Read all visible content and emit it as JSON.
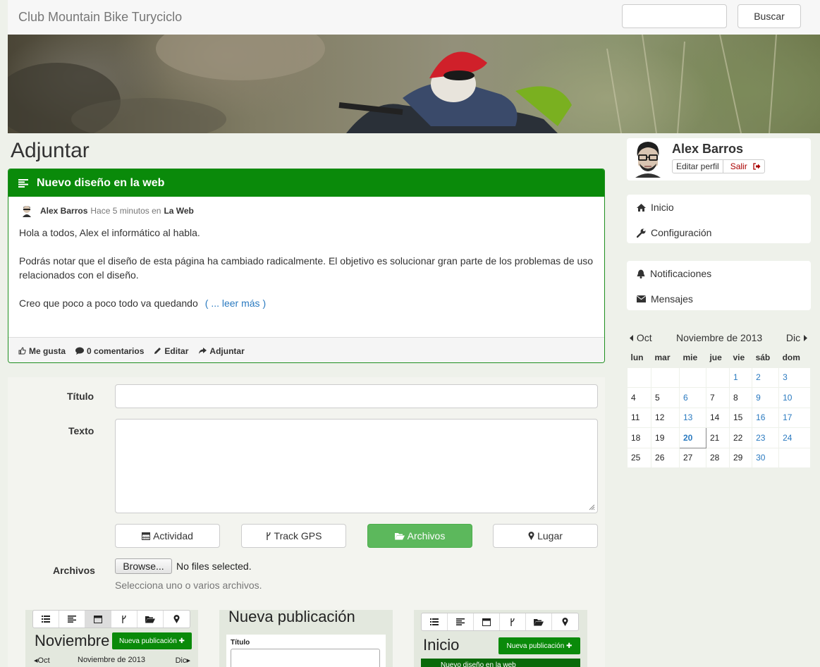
{
  "navbar": {
    "brand": "Club Mountain Bike Turyciclo",
    "search_button": "Buscar",
    "search_placeholder": ""
  },
  "page_title": "Adjuntar",
  "post": {
    "title": "Nuevo diseño en la web",
    "author": "Alex Barros",
    "time": "Hace 5 minutos en",
    "category": "La Web",
    "paragraphs": [
      "Hola a todos, Alex el informático al habla.",
      "Podrás notar que el diseño de esta página ha cambiado radicalmente. El objetivo es solucionar gran parte de los problemas de uso relacionados con el diseño.",
      "Creo que poco a poco todo va quedando"
    ],
    "read_more": "( ... leer más )",
    "actions": {
      "like": "Me gusta",
      "comments": "0 comentarios",
      "edit": "Editar",
      "attach": "Adjuntar"
    }
  },
  "form": {
    "title_label": "Título",
    "text_label": "Texto",
    "types": [
      "Actividad",
      "Track GPS",
      "Archivos",
      "Lugar"
    ],
    "active_type": "Archivos",
    "files_label": "Archivos",
    "browse_label": "Browse...",
    "no_file": "No files selected.",
    "help": "Selecciona uno o varios archivos."
  },
  "thumbnails": {
    "left": {
      "heading": "Noviembre",
      "button": "Nueva publicación ✚",
      "cal_prev": "◂Oct",
      "cal_month": "Noviembre de 2013",
      "cal_next": "Dic▸"
    },
    "middle": {
      "heading": "Nueva publicación",
      "label": "Título"
    },
    "right": {
      "heading": "Inicio",
      "button": "Nueva publicación ✚",
      "bar_text": "Nuevo diseño en la web"
    }
  },
  "profile": {
    "name": "Alex Barros",
    "edit": "Editar perfil",
    "logout": "Salir"
  },
  "nav1": [
    "Inicio",
    "Configuración"
  ],
  "nav2": [
    "Notificaciones",
    "Mensajes"
  ],
  "calendar": {
    "prev": "Oct",
    "month": "Noviembre de 2013",
    "next": "Dic",
    "weekdays": [
      "lun",
      "mar",
      "mie",
      "jue",
      "vie",
      "sáb",
      "dom"
    ],
    "weeks": [
      [
        "",
        "",
        "",
        "",
        "1",
        "2",
        "3"
      ],
      [
        "4",
        "5",
        "6",
        "7",
        "8",
        "9",
        "10"
      ],
      [
        "11",
        "12",
        "13",
        "14",
        "15",
        "16",
        "17"
      ],
      [
        "18",
        "19",
        "20",
        "21",
        "22",
        "23",
        "24"
      ],
      [
        "25",
        "26",
        "27",
        "28",
        "29",
        "30",
        ""
      ]
    ],
    "event_days": [
      "1",
      "2",
      "3",
      "6",
      "9",
      "10",
      "13",
      "16",
      "17",
      "20",
      "23",
      "24",
      "30"
    ],
    "today": "20",
    "link_color": "#2a7ac0"
  },
  "colors": {
    "panel_header": "#0a8a0a",
    "active_button": "#5cb85c",
    "link": "#2a7ac0",
    "logout": "#aa0000"
  }
}
